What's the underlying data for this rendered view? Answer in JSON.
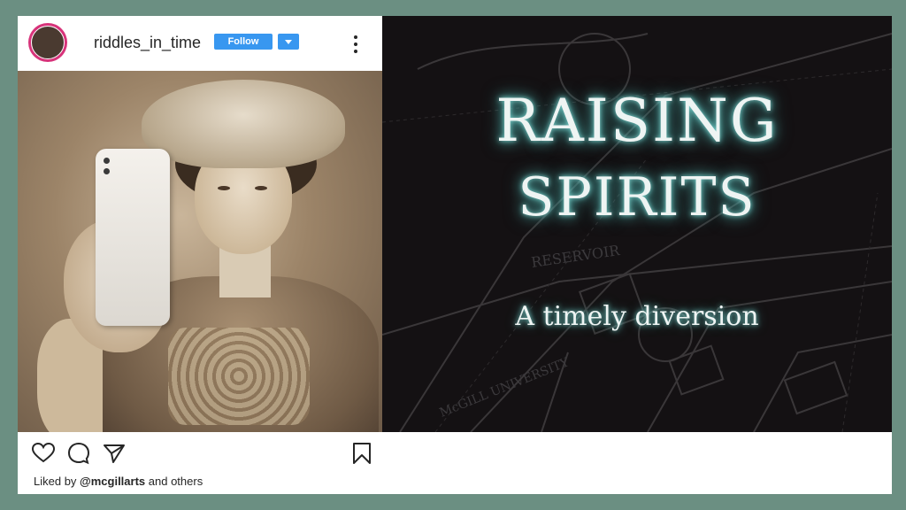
{
  "post": {
    "username": "riddles_in_time",
    "follow_label": "Follow",
    "more_icon": "more-vertical-icon"
  },
  "banner": {
    "title_line1": "RAISING",
    "title_line2": "SPIRITS",
    "subtitle": "A timely diversion",
    "map_labels": [
      "RESERVOIR",
      "McGILL UNIVERSITY"
    ],
    "glow_color": "#7fd9d4"
  },
  "actions": {
    "icons": [
      "heart-icon",
      "comment-icon",
      "share-icon",
      "bookmark-icon"
    ],
    "liked_prefix": "Liked by",
    "liked_user": "@mcgillarts",
    "liked_suffix": "and others"
  },
  "colors": {
    "background": "#6b8f82",
    "follow_button": "#3897f0"
  }
}
